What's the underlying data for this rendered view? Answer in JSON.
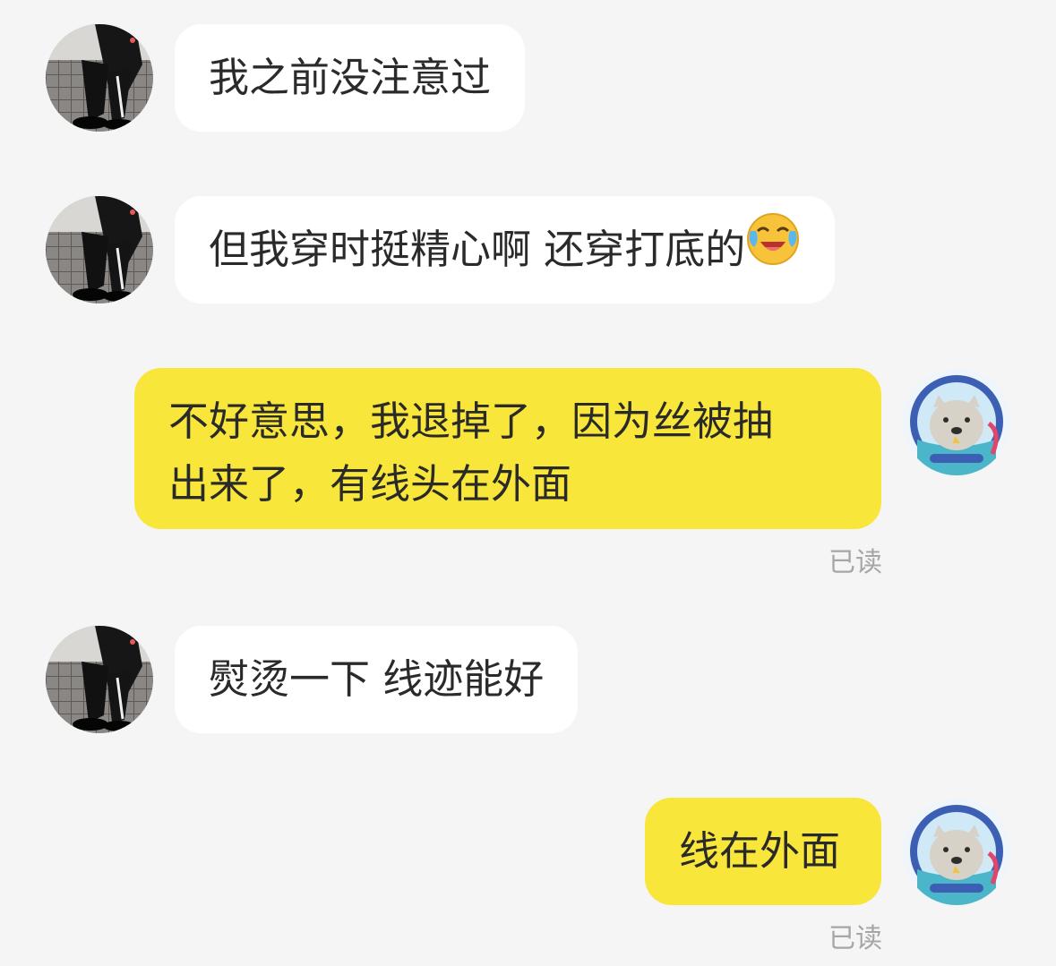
{
  "messages": [
    {
      "text": "我之前没注意过"
    },
    {
      "text": "但我穿时挺精心啊 还穿打底的"
    },
    {
      "lines": [
        "不好意思，我退掉了，因为丝被抽",
        "出来了，有线头在外面"
      ],
      "status": "已读"
    },
    {
      "text": "熨烫一下 线迹能好"
    },
    {
      "text": "线在外面",
      "status": "已读"
    }
  ],
  "icons": {
    "contact_avatar": "person-photo-avatar",
    "self_avatar": "seal-astronaut-avatar",
    "emoji": "laughing-crying-emoji"
  },
  "colors": {
    "background": "#f5f5f5",
    "incoming_bubble": "#ffffff",
    "outgoing_bubble": "#f8e63b",
    "text": "#2a2a2a",
    "read_status": "#a6a6a6"
  }
}
